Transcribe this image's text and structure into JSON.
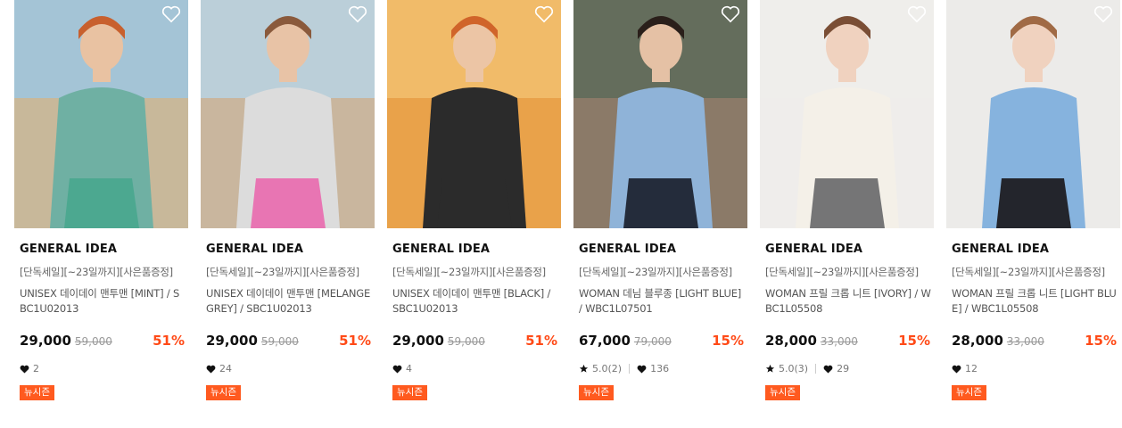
{
  "products": [
    {
      "brand": "GENERAL IDEA",
      "promo": "[단독세일][~23일까지][사은품증정]",
      "name": "UNISEX 데이데이 맨투맨 [MINT] / SBC1U02013",
      "price": "29,000",
      "original_price": "59,000",
      "discount": "51%",
      "likes": "2",
      "badge": "뉴시즌",
      "image_desc": "man in mint sweatshirt and shorts on bleachers",
      "palette": {
        "bg": "#c8b89a",
        "sky": "#9ec6e0",
        "top": "#6fb0a3",
        "bottom": "#4aa88f",
        "skin": "#e9c2a2",
        "hair": "#c8602e"
      }
    },
    {
      "brand": "GENERAL IDEA",
      "promo": "[단독세일][~23일까지][사은품증정]",
      "name": "UNISEX 데이데이 맨투맨 [MELANGE GREY] / SBC1U02013",
      "price": "29,000",
      "original_price": "59,000",
      "discount": "51%",
      "likes": "24",
      "badge": "뉴시즌",
      "image_desc": "woman in grey sweatshirt and pink shorts",
      "palette": {
        "bg": "#c9b69e",
        "sky": "#b9d3e3",
        "top": "#dcdcdc",
        "bottom": "#e86fb0",
        "skin": "#e8c3a6",
        "hair": "#8a5a3c"
      }
    },
    {
      "brand": "GENERAL IDEA",
      "promo": "[단독세일][~23일까지][사은품증정]",
      "name": "UNISEX 데이데이 맨투맨 [BLACK] / SBC1U02013",
      "price": "29,000",
      "original_price": "59,000",
      "discount": "51%",
      "likes": "4",
      "badge": "뉴시즌",
      "image_desc": "man in black sweatshirt with sunglasses",
      "palette": {
        "bg": "#e9a24a",
        "sky": "#f2c06f",
        "top": "#2b2b2b",
        "bottom": "#2b2b2b",
        "skin": "#ecc5a5",
        "hair": "#d0642a"
      }
    },
    {
      "brand": "GENERAL IDEA",
      "promo": "[단독세일][~23일까지][사은품증정]",
      "name": "WOMAN 데님 블루종 [LIGHT BLUE] / WBC1L07501",
      "price": "67,000",
      "original_price": "79,000",
      "discount": "15%",
      "rating": "5.0(2)",
      "likes": "136",
      "badge": "뉴시즌",
      "image_desc": "woman in light blue denim jacket",
      "palette": {
        "bg": "#8b7a68",
        "sky": "#5d6b5a",
        "top": "#8fb3d8",
        "bottom": "#1f2533",
        "skin": "#e5c1a5",
        "hair": "#2a1f1a"
      }
    },
    {
      "brand": "GENERAL IDEA",
      "promo": "[단독세일][~23일까지][사은품증정]",
      "name": "WOMAN 프릴 크롭 니트 [IVORY] / WBC1L05508",
      "price": "28,000",
      "original_price": "33,000",
      "discount": "15%",
      "rating": "5.0(3)",
      "likes": "29",
      "badge": "뉴시즌",
      "image_desc": "woman in ivory cropped knit and grey skirt",
      "palette": {
        "bg": "#efedeb",
        "sky": "#efedeb",
        "top": "#f4f0e8",
        "bottom": "#6e6e70",
        "skin": "#f0d2bf",
        "hair": "#7a4e35"
      }
    },
    {
      "brand": "GENERAL IDEA",
      "promo": "[단독세일][~23일까지][사은품증정]",
      "name": "WOMAN 프릴 크롭 니트 [LIGHT BLUE] / WBC1L05508",
      "price": "28,000",
      "original_price": "33,000",
      "discount": "15%",
      "likes": "12",
      "badge": "뉴시즌",
      "image_desc": "woman in light blue cropped knit and black skirt",
      "palette": {
        "bg": "#ecebe9",
        "sky": "#ecebe9",
        "top": "#86b3de",
        "bottom": "#1e1e22",
        "skin": "#f0d2bf",
        "hair": "#a06a45"
      }
    }
  ]
}
